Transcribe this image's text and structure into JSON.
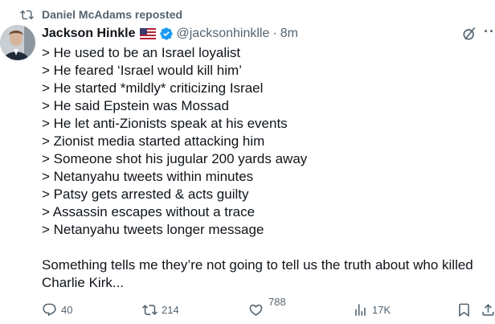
{
  "repost": {
    "label": "Daniel McAdams reposted",
    "icon": "repost-icon"
  },
  "author": {
    "name": "Jackson Hinkle",
    "flag": "us-flag-icon",
    "verified_icon": "verified-badge-icon",
    "handle": "@jacksonhinklle",
    "separator": "·",
    "time": "8m"
  },
  "tweet": {
    "lines": [
      "> He used to be an Israel loyalist",
      "> He feared ‘Israel would kill him’",
      "> He started *mildly* criticizing Israel",
      "> He said Epstein was Mossad",
      "> He let anti-Zionists speak at his events",
      "> Zionist media started attacking him",
      "> Someone shot his jugular 200 yards away",
      "> Netanyahu tweets within minutes",
      "> Patsy gets arrested & acts guilty",
      "> Assassin escapes without a trace",
      "> Netanyahu tweets longer message"
    ],
    "closing_line_1": "Something tells me they’re not going to tell us the truth about who killed",
    "closing_line_2": "Charlie Kirk..."
  },
  "actions": {
    "replies": "40",
    "reposts": "214",
    "likes": "788",
    "views": "17K"
  },
  "colors": {
    "text": "#0f1419",
    "muted": "#536471",
    "verified": "#1d9bf0"
  }
}
